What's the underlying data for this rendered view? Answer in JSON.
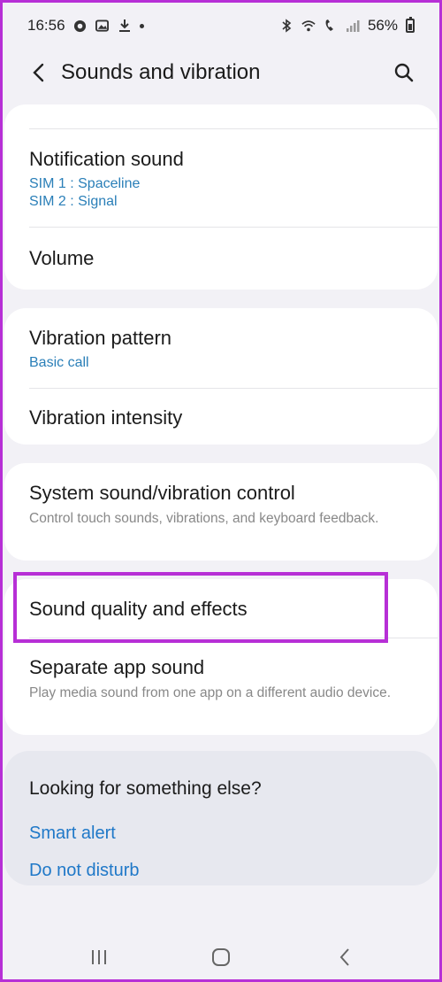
{
  "status_bar": {
    "time": "16:56",
    "battery_percent": "56%"
  },
  "app_bar": {
    "title": "Sounds and vibration"
  },
  "cards": {
    "notification_sound": {
      "title": "Notification sound",
      "sim1": "SIM 1 : Spaceline",
      "sim2": "SIM 2 : Signal"
    },
    "volume": {
      "title": "Volume"
    },
    "vibration_pattern": {
      "title": "Vibration pattern",
      "value": "Basic call"
    },
    "vibration_intensity": {
      "title": "Vibration intensity"
    },
    "system_control": {
      "title": "System sound/vibration control",
      "description": "Control touch sounds, vibrations, and keyboard feedback."
    },
    "sound_quality": {
      "title": "Sound quality and effects"
    },
    "separate_app_sound": {
      "title": "Separate app sound",
      "description": "Play media sound from one app on a different audio device."
    }
  },
  "suggestions": {
    "title": "Looking for something else?",
    "links": [
      "Smart alert",
      "Do not disturb"
    ]
  },
  "colors": {
    "accent_link": "#1f78c8",
    "highlight": "#b72fd6"
  },
  "icons": {
    "back": "back-arrow-icon",
    "search": "search-icon",
    "nav_recents": "recents-icon",
    "nav_home": "home-icon",
    "nav_back": "nav-back-icon"
  }
}
